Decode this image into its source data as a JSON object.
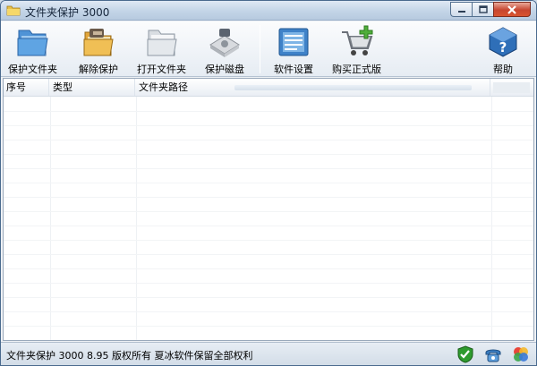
{
  "window": {
    "title": "文件夹保护 3000"
  },
  "toolbar": {
    "protect_folder": "保护文件夹",
    "remove_protection": "解除保护",
    "open_folder": "打开文件夹",
    "protect_disk": "保护磁盘",
    "software_settings": "软件设置",
    "buy_full_version": "购买正式版",
    "help": "帮助"
  },
  "list": {
    "columns": [
      "序号",
      "类型",
      "文件夹路径",
      ""
    ],
    "rows": []
  },
  "statusbar": {
    "text": "文件夹保护 3000 8.95 版权所有 夏冰软件保留全部权利"
  },
  "icons": {
    "protect_folder": "folder-icon",
    "remove_protection": "folder-unlock-icon",
    "open_folder": "open-folder-icon",
    "protect_disk": "disk-icon",
    "software_settings": "settings-panel-icon",
    "buy_full_version": "shopping-cart-icon",
    "help": "help-icon",
    "status_shield": "shield-check-icon",
    "status_phone": "phone-icon",
    "status_colors": "color-wheel-icon"
  },
  "colors": {
    "accent": "#2f6fb8",
    "window_border": "#4a6a8e",
    "close_button": "#c7452f"
  }
}
